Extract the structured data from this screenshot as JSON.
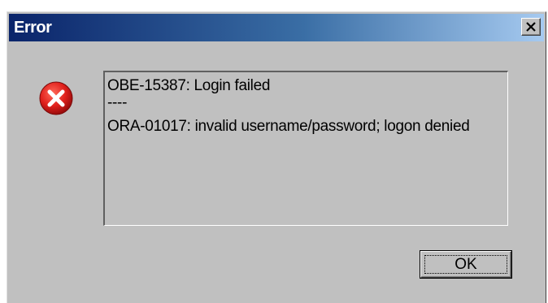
{
  "window": {
    "title": "Error",
    "close_icon": "close-icon"
  },
  "icon": {
    "name": "error-icon",
    "color": "#d81e1e"
  },
  "message": {
    "line1": "OBE-15387: Login failed",
    "line2": "----",
    "line3": "ORA-01017: invalid username/password; logon denied"
  },
  "buttons": {
    "ok_label": "OK"
  },
  "colors": {
    "titlebar_start": "#0a246a",
    "titlebar_end": "#a6caf0",
    "dialog_bg": "#c0c0c0"
  }
}
